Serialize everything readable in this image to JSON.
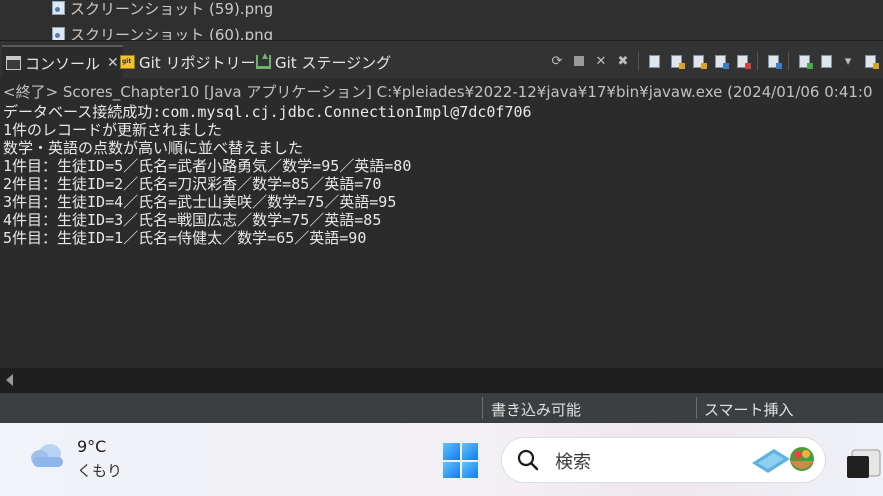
{
  "files": [
    {
      "name": "スクリーンショット (59).png",
      "icon": "image-file-icon"
    },
    {
      "name": "スクリーンショット (60).png",
      "icon": "image-file-icon"
    }
  ],
  "tabs": [
    {
      "label": "コンソール",
      "icon": "console-icon",
      "active": true
    },
    {
      "label": "Git リポジトリー",
      "icon": "git-repo-icon",
      "active": false
    },
    {
      "label": "Git ステージング",
      "icon": "git-staging-icon",
      "active": false
    }
  ],
  "console": {
    "header": "<終了> Scores_Chapter10 [Java アプリケーション] C:¥pleiades¥2022-12¥java¥17¥bin¥javaw.exe  (2024/01/06 0:41:0",
    "lines": [
      "データベース接続成功:com.mysql.cj.jdbc.ConnectionImpl@7dc0f706",
      "1件のレコードが更新されました",
      "数学・英語の点数が高い順に並べ替えました",
      "1件目：生徒ID=5／氏名=武者小路勇気／数学=95／英語=80",
      "2件目：生徒ID=2／氏名=刀沢彩香／数学=85／英語=70",
      "3件目：生徒ID=4／氏名=武士山美咲／数学=75／英語=95",
      "4件目：生徒ID=3／氏名=戦国広志／数学=75／英語=85",
      "5件目：生徒ID=1／氏名=侍健太／数学=65／英語=90"
    ]
  },
  "status": {
    "mode": "書き込み可能",
    "insert": "スマート挿入"
  },
  "taskbar": {
    "temperature": "9°C",
    "condition": "くもり",
    "search_placeholder": "検索"
  }
}
